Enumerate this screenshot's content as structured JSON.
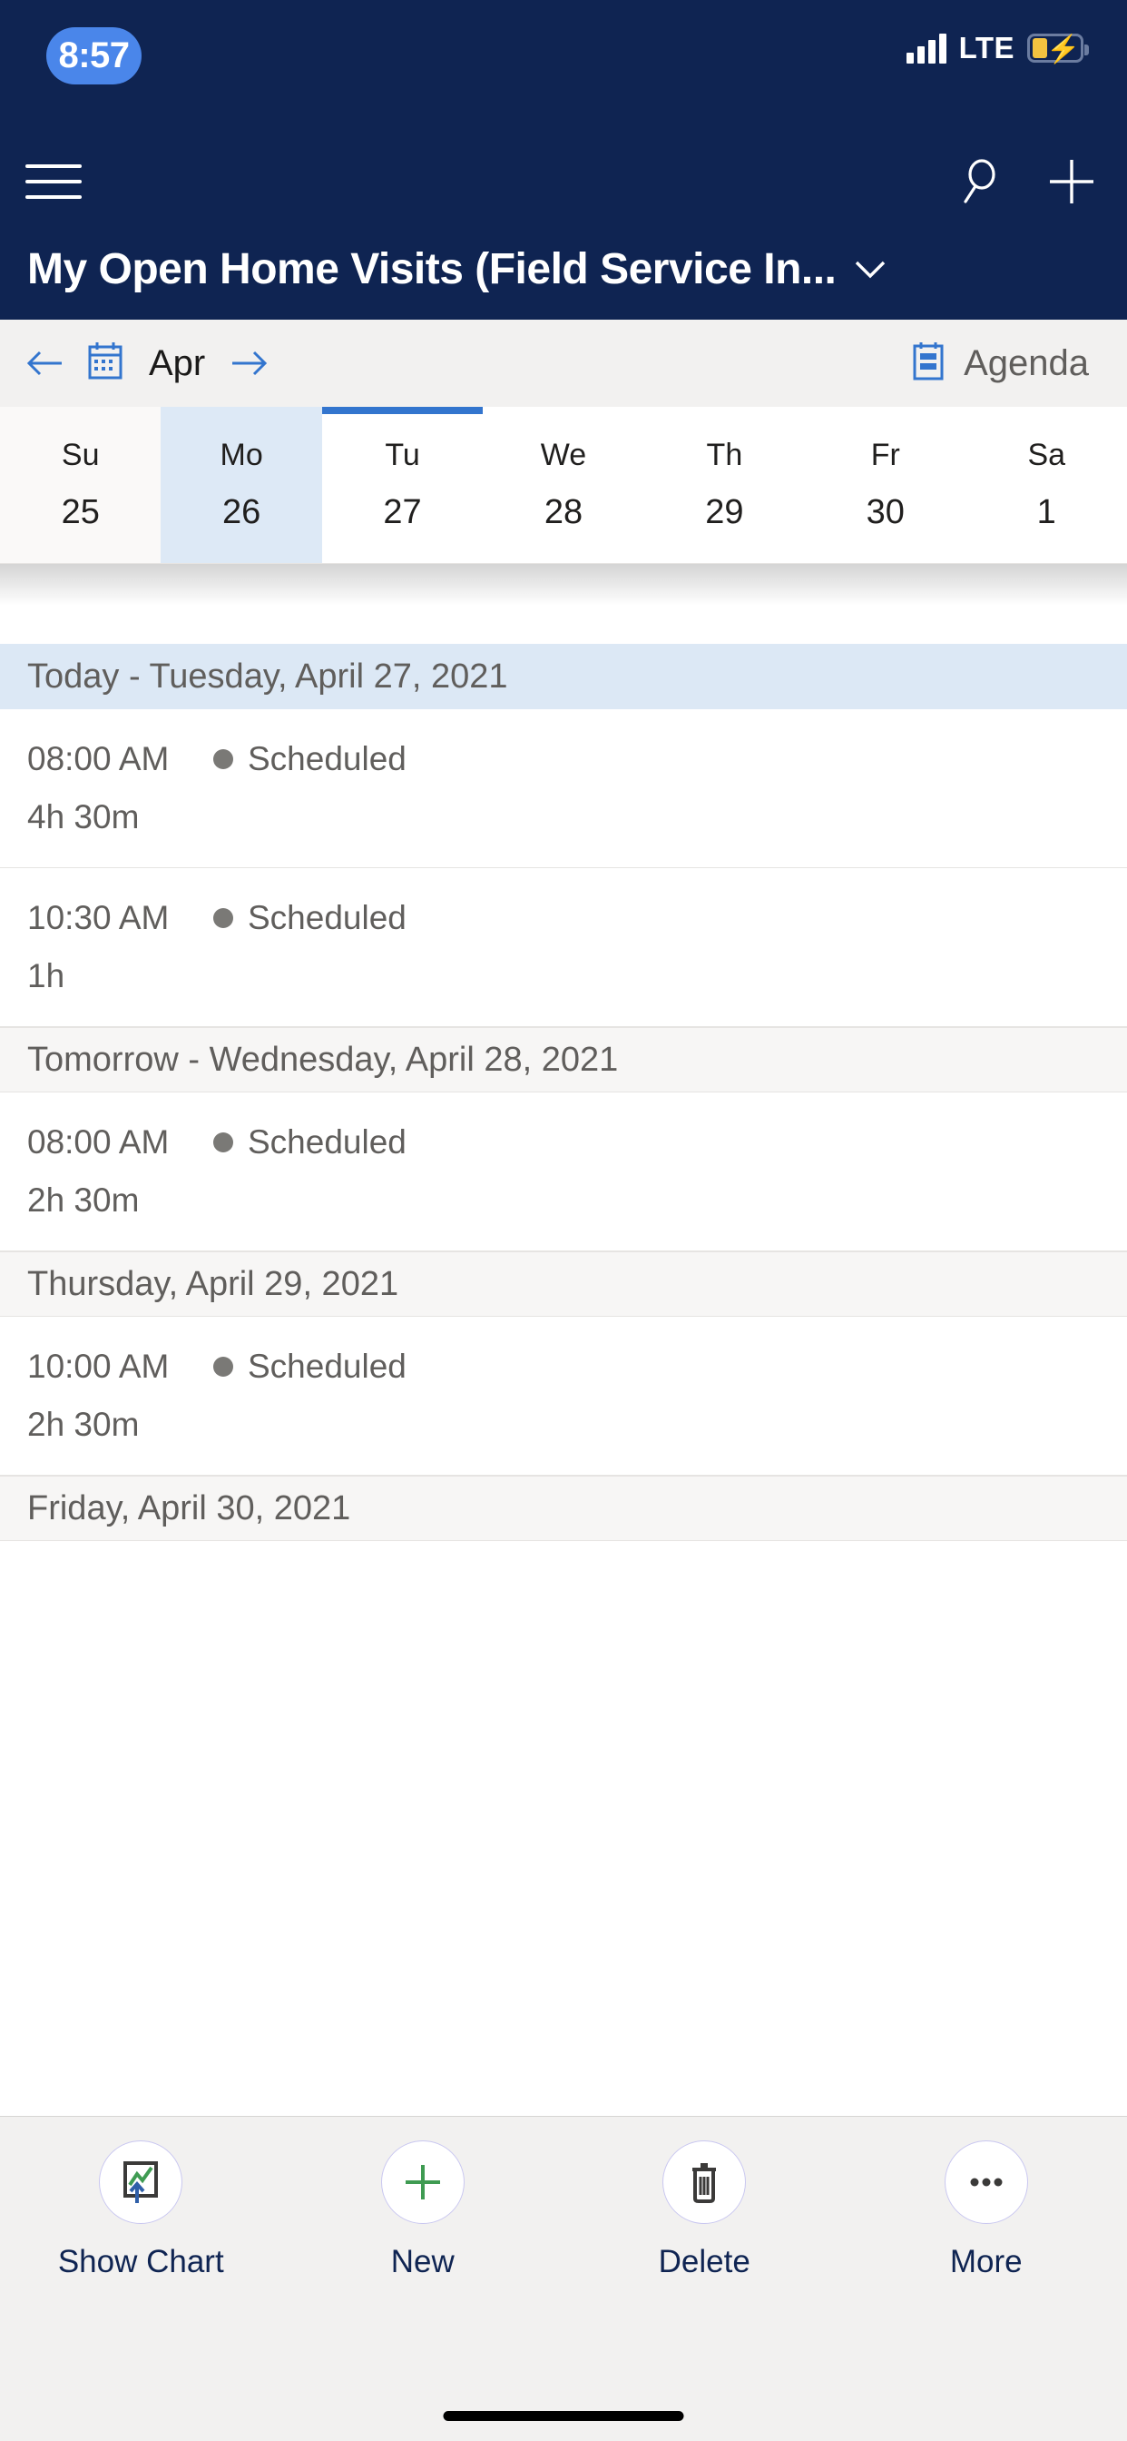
{
  "status_bar": {
    "time": "8:57",
    "network": "LTE",
    "signal_icon": "signal-bars-icon",
    "battery_icon": "battery-charging-icon"
  },
  "app_bar": {
    "menu_icon": "hamburger-menu-icon",
    "search_icon": "search-icon",
    "new_icon": "plus-icon",
    "title": "My Open Home Visits (Field Service In...",
    "title_chevron_icon": "chevron-down-icon"
  },
  "calendar_nav": {
    "prev_icon": "arrow-left-icon",
    "calendar_icon": "calendar-icon",
    "month": "Apr",
    "next_icon": "arrow-right-icon",
    "view_icon": "agenda-list-icon",
    "view_label": "Agenda",
    "accent_color": "#3375ce"
  },
  "day_strip": {
    "days": [
      {
        "dow": "Su",
        "num": "25",
        "state": "sunday"
      },
      {
        "dow": "Mo",
        "num": "26",
        "state": "selected"
      },
      {
        "dow": "Tu",
        "num": "27",
        "state": "marked"
      },
      {
        "dow": "We",
        "num": "28",
        "state": "normal"
      },
      {
        "dow": "Th",
        "num": "29",
        "state": "normal"
      },
      {
        "dow": "Fr",
        "num": "30",
        "state": "normal"
      },
      {
        "dow": "Sa",
        "num": "1",
        "state": "normal"
      }
    ]
  },
  "agenda": {
    "sections": [
      {
        "header": "Today - Tuesday, April 27, 2021",
        "style": "today",
        "items": [
          {
            "time": "08:00 AM",
            "status": "Scheduled",
            "duration": "4h 30m",
            "status_color": "#7a7976"
          },
          {
            "time": "10:30 AM",
            "status": "Scheduled",
            "duration": "1h",
            "status_color": "#7a7976"
          }
        ]
      },
      {
        "header": "Tomorrow - Wednesday, April 28, 2021",
        "style": "plain",
        "items": [
          {
            "time": "08:00 AM",
            "status": "Scheduled",
            "duration": "2h 30m",
            "status_color": "#7a7976"
          }
        ]
      },
      {
        "header": "Thursday, April 29, 2021",
        "style": "plain",
        "items": [
          {
            "time": "10:00 AM",
            "status": "Scheduled",
            "duration": "2h 30m",
            "status_color": "#7a7976"
          }
        ]
      },
      {
        "header": "Friday, April 30, 2021",
        "style": "plain",
        "items": []
      }
    ]
  },
  "toolbar": {
    "buttons": [
      {
        "label": "Show Chart",
        "icon": "chart-icon"
      },
      {
        "label": "New",
        "icon": "plus-icon"
      },
      {
        "label": "Delete",
        "icon": "trash-icon"
      },
      {
        "label": "More",
        "icon": "ellipsis-icon"
      }
    ]
  }
}
